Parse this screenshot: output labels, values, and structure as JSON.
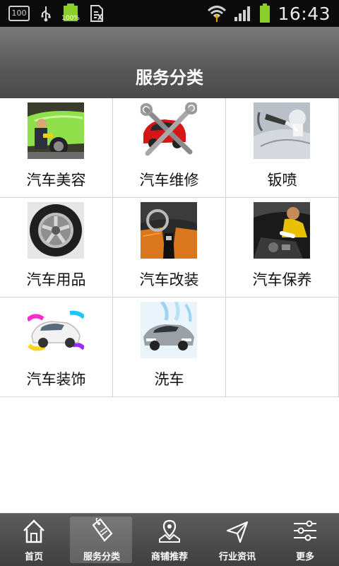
{
  "status_bar": {
    "left_icons": [
      "sim-100-icon",
      "usb-icon",
      "battery-100-icon",
      "document-icon"
    ],
    "battery_small_label": "100%",
    "sim_label": "100",
    "right_icons": [
      "wifi-icon",
      "signal-icon",
      "battery-icon"
    ],
    "time": "16:43"
  },
  "header": {
    "title": "服务分类"
  },
  "categories": [
    {
      "label": "汽车美容",
      "icon": "car-beauty-image"
    },
    {
      "label": "汽车维修",
      "icon": "car-repair-image"
    },
    {
      "label": "钣喷",
      "icon": "spray-paint-image"
    },
    {
      "label": "汽车用品",
      "icon": "wheel-image"
    },
    {
      "label": "汽车改装",
      "icon": "car-interior-image"
    },
    {
      "label": "汽车保养",
      "icon": "engine-maintenance-image"
    },
    {
      "label": "汽车装饰",
      "icon": "car-decoration-image"
    },
    {
      "label": "洗车",
      "icon": "car-wash-image"
    }
  ],
  "tabs": [
    {
      "label": "首页",
      "icon": "home-icon",
      "active": false
    },
    {
      "label": "服务分类",
      "icon": "sale-tag-icon",
      "active": true
    },
    {
      "label": "商铺推荐",
      "icon": "map-pin-icon",
      "active": false
    },
    {
      "label": "行业资讯",
      "icon": "send-icon",
      "active": false
    },
    {
      "label": "更多",
      "icon": "sliders-icon",
      "active": false
    }
  ],
  "colors": {
    "accent_green": "#8ccf2a",
    "header_gray": "#5a5a5a",
    "tabbar_gray": "#4a4a4a"
  }
}
